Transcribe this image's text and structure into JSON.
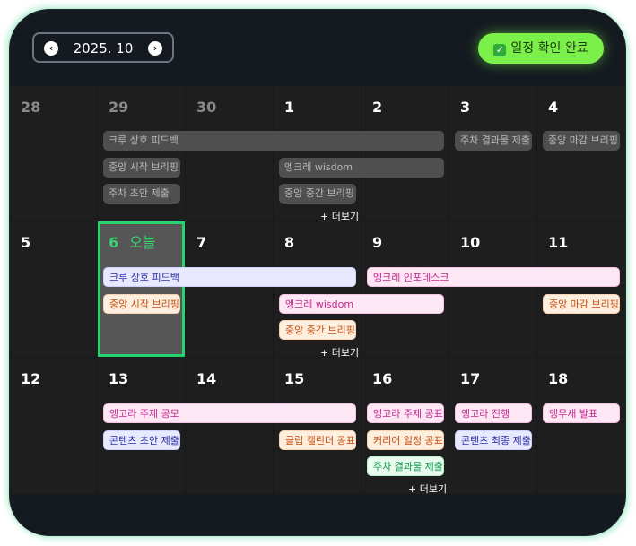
{
  "header": {
    "month": "2025. 10",
    "prev_icon": "chevron-left-icon",
    "next_icon": "chevron-right-icon",
    "prev_glyph": "‹",
    "next_glyph": "›",
    "confirm_label": "일정 확인 완료",
    "confirm_check": "✓",
    "confirm_color": "#7cf04a"
  },
  "today_label": "오늘",
  "more_label": "+ 더보기",
  "accent_today": "#27d36c",
  "weeks": [
    {
      "days": [
        "28",
        "29",
        "30",
        "1",
        "2",
        "3",
        "4"
      ],
      "events": [
        {
          "text": "크루 상호 피드백",
          "style": "past"
        },
        {
          "text": "중앙 시작 브리핑",
          "style": "past"
        },
        {
          "text": "주차 초안 제출",
          "style": "past"
        },
        {
          "text": "엥크레 wisdom",
          "style": "past"
        },
        {
          "text": "중앙 중간 브리핑",
          "style": "past"
        },
        {
          "text": "주차 결과물 제출",
          "style": "past"
        },
        {
          "text": "중앙 마감 브리핑",
          "style": "past"
        }
      ]
    },
    {
      "days": [
        "5",
        "6",
        "7",
        "8",
        "9",
        "10",
        "11"
      ],
      "events": [
        {
          "text": "크루 상호 피드백",
          "style": "lavender"
        },
        {
          "text": "엥크레 인포데스크",
          "style": "pink"
        },
        {
          "text": "중앙 시작 브리핑",
          "style": "peach"
        },
        {
          "text": "엥크레 wisdom",
          "style": "pink"
        },
        {
          "text": "중앙 마감 브리핑",
          "style": "peach"
        },
        {
          "text": "중앙 중간 브리핑",
          "style": "peach"
        }
      ]
    },
    {
      "days": [
        "12",
        "13",
        "14",
        "15",
        "16",
        "17",
        "18"
      ],
      "events": [
        {
          "text": "엥고라 주제 공모",
          "style": "pink"
        },
        {
          "text": "엥고라 주제 공표",
          "style": "pink"
        },
        {
          "text": "엥고라 진행",
          "style": "pink"
        },
        {
          "text": "엥무새 발표",
          "style": "pink"
        },
        {
          "text": "콘텐츠 초안 제출",
          "style": "lavender"
        },
        {
          "text": "클럽 캘린더 공표",
          "style": "peach"
        },
        {
          "text": "커리어 일정 공표",
          "style": "peach"
        },
        {
          "text": "콘텐츠 최종 제출",
          "style": "lavender"
        },
        {
          "text": "주차 결과물 제출",
          "style": "mint"
        }
      ]
    }
  ]
}
